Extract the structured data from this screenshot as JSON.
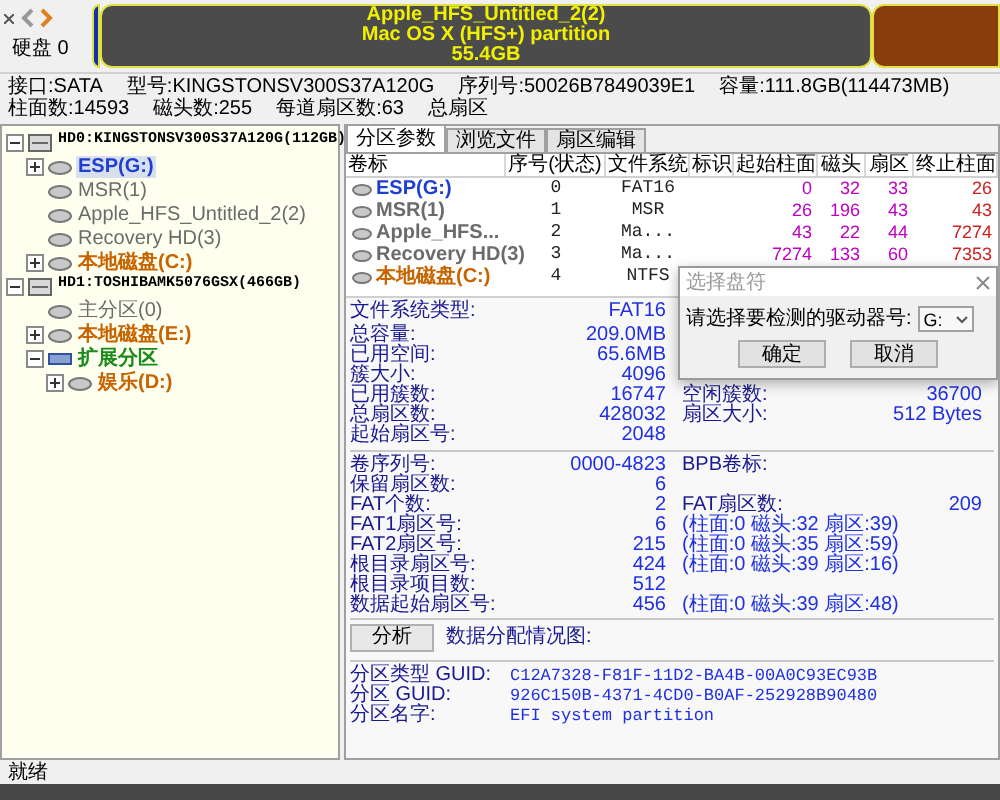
{
  "disk_map": {
    "label": "硬盘 0",
    "segments": [
      {
        "kind": "esp"
      },
      {
        "kind": "hfs",
        "lines": [
          "Apple_HFS_Untitled_2(2)",
          "Mac OS X (HFS+) partition",
          "55.4GB"
        ]
      },
      {
        "kind": "ntfs"
      }
    ]
  },
  "disk_info": [
    "接口:SATA",
    "型号:KINGSTONSV300S37A120G",
    "序列号:50026B7849039E1",
    "容量:111.8GB(114473MB)",
    "柱面数:14593",
    "磁头数:255",
    "每道扇区数:63",
    "总扇区"
  ],
  "tree": [
    {
      "kind": "disk",
      "label": "HD0:KINGSTONSV300S37A120G(112GB)",
      "selected": false,
      "expanded": true,
      "children": [
        {
          "kind": "partition",
          "label": "ESP(G:)",
          "color": "#1f3fd0",
          "selected": true,
          "expanded": false
        },
        {
          "kind": "partition",
          "label": "MSR(1)",
          "color": "#6b6b6b",
          "selected": false
        },
        {
          "kind": "partition",
          "label": "Apple_HFS_Untitled_2(2)",
          "color": "#6b6b6b",
          "selected": false
        },
        {
          "kind": "partition",
          "label": "Recovery HD(3)",
          "color": "#6b6b6b",
          "selected": false
        },
        {
          "kind": "partition",
          "label": "本地磁盘(C:)",
          "color": "#c86400",
          "selected": false,
          "expanded": false
        }
      ]
    },
    {
      "kind": "disk",
      "label": "HD1:TOSHIBAMK5076GSX(466GB)",
      "selected": false,
      "expanded": true,
      "children": [
        {
          "kind": "partition",
          "label": "主分区(0)",
          "color": "#6b6b6b",
          "selected": false
        },
        {
          "kind": "partition",
          "label": "本地磁盘(E:)",
          "color": "#c86400",
          "selected": false,
          "expanded": false
        },
        {
          "kind": "extended",
          "label": "扩展分区",
          "color": "#1a8a1a",
          "selected": false,
          "expanded": true,
          "children": [
            {
              "kind": "partition",
              "label": "娱乐(D:)",
              "color": "#c86400",
              "selected": false,
              "expanded": false
            }
          ]
        }
      ]
    }
  ],
  "tabs": [
    {
      "label": "分区参数",
      "selected": true
    },
    {
      "label": "浏览文件",
      "selected": false
    },
    {
      "label": "扇区编辑",
      "selected": false
    }
  ],
  "table": {
    "columns": [
      "卷标",
      "序号(状态)",
      "文件系统",
      "标识",
      "起始柱面",
      "磁头",
      "扇区",
      "终止柱面"
    ],
    "rows": [
      {
        "color": "#1f3fd0",
        "cells": [
          "ESP(G:)",
          "0",
          "FAT16",
          "",
          "0",
          "32",
          "33",
          "26"
        ]
      },
      {
        "color": "#6b6b6b",
        "cells": [
          "MSR(1)",
          "1",
          "MSR",
          "",
          "26",
          "196",
          "43",
          "43"
        ]
      },
      {
        "color": "#6b6b6b",
        "cells": [
          "Apple_HFS...",
          "2",
          "Ma...",
          "",
          "43",
          "22",
          "44",
          "7274"
        ]
      },
      {
        "color": "#6b6b6b",
        "cells": [
          "Recovery HD(3)",
          "3",
          "Ma...",
          "",
          "7274",
          "133",
          "60",
          "7353"
        ]
      },
      {
        "color": "#c86400",
        "cells": [
          "本地磁盘(C:)",
          "4",
          "NTFS"
        ]
      }
    ]
  },
  "fs_info": [
    {
      "label": "文件系统类型:",
      "value": "FAT16"
    },
    {
      "label": "总容量:",
      "value": "209.0MB"
    },
    {
      "label": "已用空间:",
      "value": "65.6MB"
    },
    {
      "label": "簇大小:",
      "value": "4096"
    },
    {
      "label": "已用簇数:",
      "value": "16747",
      "label_2": "空闲簇数:",
      "value_2": "36700"
    },
    {
      "label": "总扇区数:",
      "value": "428032",
      "label_2": "扇区大小:",
      "value_2": "512 Bytes"
    },
    {
      "label": "起始扇区号:",
      "value": "2048"
    }
  ],
  "boot_info": [
    {
      "label": "卷序列号:",
      "value": "0000-4823",
      "label_2": "BPB卷标:"
    },
    {
      "label": "保留扇区数:",
      "value": "6"
    },
    {
      "label": "FAT个数:",
      "value": "2",
      "label_2": "FAT扇区数:",
      "value_2": "209"
    },
    {
      "label": "FAT1扇区号:",
      "value": "6",
      "detail": "(柱面:0 磁头:32 扇区:39)"
    },
    {
      "label": "FAT2扇区号:",
      "value": "215",
      "detail": "(柱面:0 磁头:35 扇区:59)"
    },
    {
      "label": "根目录扇区号:",
      "value": "424",
      "detail": "(柱面:0 磁头:39 扇区:16)"
    },
    {
      "label": "根目录项目数:",
      "value": "512"
    },
    {
      "label": "数据起始扇区号:",
      "value": "456",
      "detail": "(柱面:0 磁头:39 扇区:48)"
    }
  ],
  "analyze": {
    "button": "分析",
    "label": "数据分配情况图:"
  },
  "guid_info": [
    {
      "label": "分区类型 GUID:",
      "value": "C12A7328-F81F-11D2-BA4B-00A0C93EC93B"
    },
    {
      "label": "分区 GUID:",
      "value": "926C150B-4371-4CD0-B0AF-252928B90480"
    },
    {
      "label": "分区名字:",
      "value": "EFI system partition"
    }
  ],
  "dialog": {
    "title": "选择盘符",
    "prompt": "请选择要检测的驱动器号:",
    "select_value": "G:",
    "buttons": [
      "确定",
      "取消"
    ]
  },
  "status_bar": "就绪"
}
